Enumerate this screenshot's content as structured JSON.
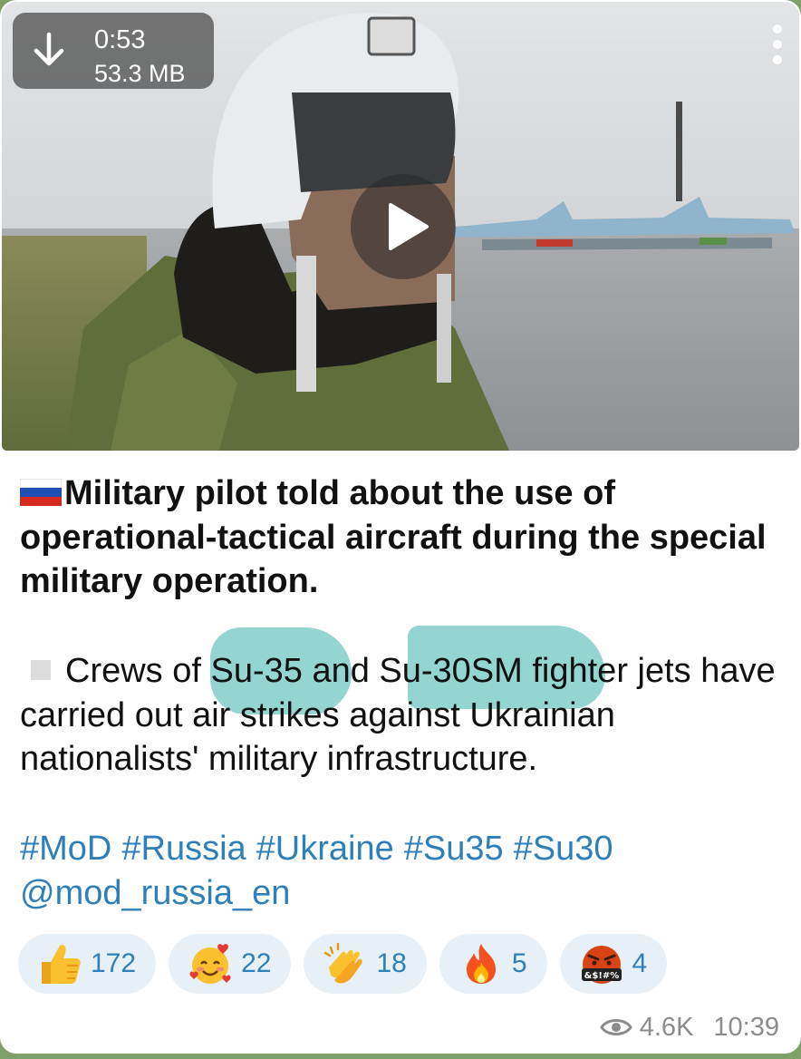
{
  "video": {
    "duration": "0:53",
    "size": "53.3 MB",
    "download_icon": "download-arrow-icon",
    "menu_icon": "more-vertical-icon",
    "play_icon": "play-icon"
  },
  "post": {
    "flag_icon": "russian-flag-icon",
    "title": "Military pilot told about the use of operational-tactical aircraft during the special military operation.",
    "bullet_icon": "square-bullet-icon",
    "body": "Crews of Su-35 and Su-30SM fighter jets have carried out air strikes against Ukrainian nationalists' military infrastructure.",
    "hashtags": [
      "#MoD",
      "#Russia",
      "#Ukraine",
      "#Su35",
      "#Su30"
    ],
    "mention": "@mod_russia_en"
  },
  "reactions": [
    {
      "emoji": "thumbs-up-icon",
      "count": "172"
    },
    {
      "emoji": "smiling-face-with-hearts-icon",
      "count": "22"
    },
    {
      "emoji": "clapping-hands-icon",
      "count": "18"
    },
    {
      "emoji": "fire-icon",
      "count": "5"
    },
    {
      "emoji": "face-with-symbols-on-mouth-icon",
      "count": "4"
    }
  ],
  "footer": {
    "views_icon": "eye-icon",
    "views": "4.6K",
    "time": "10:39"
  },
  "colors": {
    "link": "#2f7fb8",
    "reaction_bg": "#e6f0f6",
    "highlight": "#52b9b5",
    "meta": "#8c8c8c"
  }
}
